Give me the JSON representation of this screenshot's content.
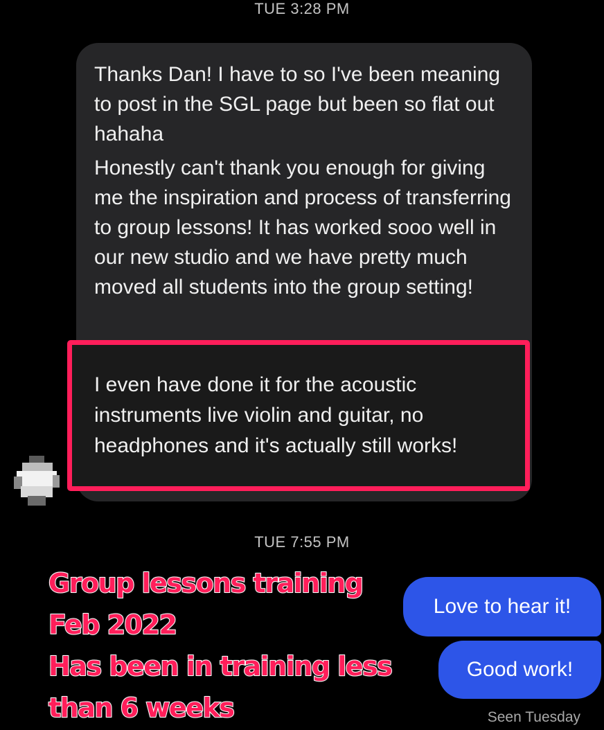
{
  "timestamps": {
    "first": "TUE 3:28 PM",
    "second": "TUE 7:55 PM"
  },
  "incoming_messages": {
    "paragraph_1": "Thanks Dan! I have to so I've been meaning to post in the SGL page but been so flat out hahaha",
    "paragraph_2": "Honestly can't thank you enough for giving me the inspiration and process of transferring to group lessons! It has worked sooo well in our new studio and we have pretty much moved all students into the group setting!",
    "paragraph_3": "I even have done it for the acoustic instruments live violin and guitar, no headphones and it's actually still works!"
  },
  "outgoing_messages": [
    {
      "text": "Love to hear it!"
    },
    {
      "text": "Good work!"
    }
  ],
  "seen_status": "Seen Tuesday",
  "overlay_caption": {
    "line_1": "Group lessons training",
    "line_2": "Feb 2022",
    "line_3": "Has been in training less",
    "line_4": "than 6 weeks"
  },
  "colors": {
    "highlight": "#ff1e5a",
    "outgoing_bubble": "#2d55e8",
    "incoming_bubble": "#262628"
  },
  "icons": {
    "avatar": "pixelated-avatar-icon"
  }
}
